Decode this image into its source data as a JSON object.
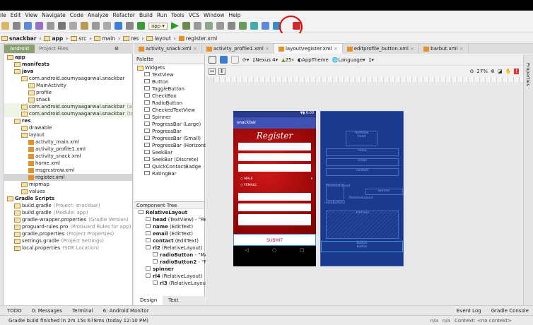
{
  "menu": [
    "ile",
    "Edit",
    "View",
    "Navigate",
    "Code",
    "Analyze",
    "Refactor",
    "Build",
    "Run",
    "Tools",
    "VCS",
    "Window",
    "Help"
  ],
  "toolbar": {
    "run_config": "app"
  },
  "breadcrumb": [
    "snackbar",
    "app",
    "src",
    "main",
    "res",
    "layout",
    "register.xml"
  ],
  "left_tabs": {
    "android": "Android",
    "project_files": "Project Files"
  },
  "tree": [
    {
      "label": "app",
      "indent": 0
    },
    {
      "label": "manifests",
      "indent": 1
    },
    {
      "label": "java",
      "indent": 1
    },
    {
      "label": "com.android.soumyaagarwal.snackbar",
      "indent": 2
    },
    {
      "label": "MainActivity",
      "indent": 3
    },
    {
      "label": "profile",
      "indent": 3
    },
    {
      "label": "snack",
      "indent": 3
    },
    {
      "label": "com.android.soumyaagarwal.snackbar",
      "hint": "(androidTest)",
      "indent": 2
    },
    {
      "label": "com.android.soumyaagarwal.snackbar",
      "hint": "(test)",
      "indent": 2
    },
    {
      "label": "res",
      "indent": 1
    },
    {
      "label": "drawable",
      "indent": 2
    },
    {
      "label": "layout",
      "indent": 2
    },
    {
      "label": "activity_main.xml",
      "indent": 3
    },
    {
      "label": "activity_profile1.xml",
      "indent": 3
    },
    {
      "label": "activity_snack.xml",
      "indent": 3
    },
    {
      "label": "home.xml",
      "indent": 3
    },
    {
      "label": "msgrcstrow.xml",
      "indent": 3
    },
    {
      "label": "register.xml",
      "indent": 3
    },
    {
      "label": "mipmap",
      "indent": 2
    },
    {
      "label": "values",
      "indent": 2
    },
    {
      "label": "Gradle Scripts",
      "indent": 0
    },
    {
      "label": "build.gradle",
      "hint": "(Project: snackbar)",
      "indent": 1
    },
    {
      "label": "build.gradle",
      "hint": "(Module: app)",
      "indent": 1
    },
    {
      "label": "gradle-wrapper.properties",
      "hint": "(Gradle Version)",
      "indent": 1
    },
    {
      "label": "proguard-rules.pro",
      "hint": "(ProGuard Rules for app)",
      "indent": 1
    },
    {
      "label": "gradle.properties",
      "hint": "(Project Properties)",
      "indent": 1
    },
    {
      "label": "settings.gradle",
      "hint": "(Project Settings)",
      "indent": 1
    },
    {
      "label": "local.properties",
      "hint": "(SDK Location)",
      "indent": 1
    }
  ],
  "editor_tabs": [
    "activity_snack.xml",
    "activity_profile1.xml",
    "layout\\register.xml",
    "editprofile_button.xml",
    "barbut.xml"
  ],
  "palette": {
    "title": "Palette",
    "group": "Widgets",
    "items": [
      "TextView",
      "Button",
      "ToggleButton",
      "CheckBox",
      "RadioButton",
      "CheckedTextView",
      "Spinner",
      "ProgressBar (Large)",
      "ProgressBar",
      "ProgressBar (Small)",
      "ProgressBar (Horizontal)",
      "SeekBar",
      "SeekBar (Discrete)",
      "QuickContactBadge",
      "RatingBar"
    ]
  },
  "component_tree": {
    "title": "Component Tree",
    "items": [
      {
        "name": "RelativeLayout",
        "type": "",
        "indent": 0
      },
      {
        "name": "head",
        "type": "(TextView) - \"Reg",
        "indent": 1
      },
      {
        "name": "name",
        "type": "(EditText)",
        "indent": 1
      },
      {
        "name": "email",
        "type": "(EditText)",
        "indent": 1
      },
      {
        "name": "contact",
        "type": "(EditText)",
        "indent": 1
      },
      {
        "name": "rl2",
        "type": "(RelativeLayout)",
        "indent": 1
      },
      {
        "name": "radioButton",
        "type": "- \"MA",
        "indent": 2
      },
      {
        "name": "radioButton2",
        "type": "- \"F",
        "indent": 2
      },
      {
        "name": "spinner",
        "type": "",
        "indent": 1
      },
      {
        "name": "rl4",
        "type": "(RelativeLayout)",
        "indent": 1
      },
      {
        "name": "rl3",
        "type": "(RelativeLayout",
        "indent": 2
      }
    ]
  },
  "design_tabs": [
    "Design",
    "Text"
  ],
  "canvas_toolbar": {
    "device": "Nexus 4",
    "api": "25",
    "theme": "AppTheme",
    "language": "Language",
    "zoom": "27%"
  },
  "phone": {
    "time": "6:00",
    "app_title": "snackbar",
    "heading": "Register",
    "radio1": "MALE",
    "radio2": "FEMALE",
    "submit": "SUBMIT"
  },
  "blueprint": {
    "head": "TextView\nhead",
    "name": "name",
    "email": "email",
    "contact": "contact",
    "rl": "RelativeLayout",
    "radio": "radioButton2",
    "spinner": "spinner",
    "rl2": "RelativeLayout",
    "edittext": "EditText",
    "button": "Button\nbutton"
  },
  "right_strip": "Properties",
  "bottom_tools": [
    "TODO",
    "0: Messages",
    "Terminal",
    "6: Android Monitor"
  ],
  "bottom_right": [
    "Event Log",
    "Gradle Console"
  ],
  "status": {
    "message": "Gradle build finished in 2m 15s 678ms (today 12:10 PM)",
    "pos1": "n/a",
    "pos2": "n/a",
    "context": "Context: <no context>"
  }
}
